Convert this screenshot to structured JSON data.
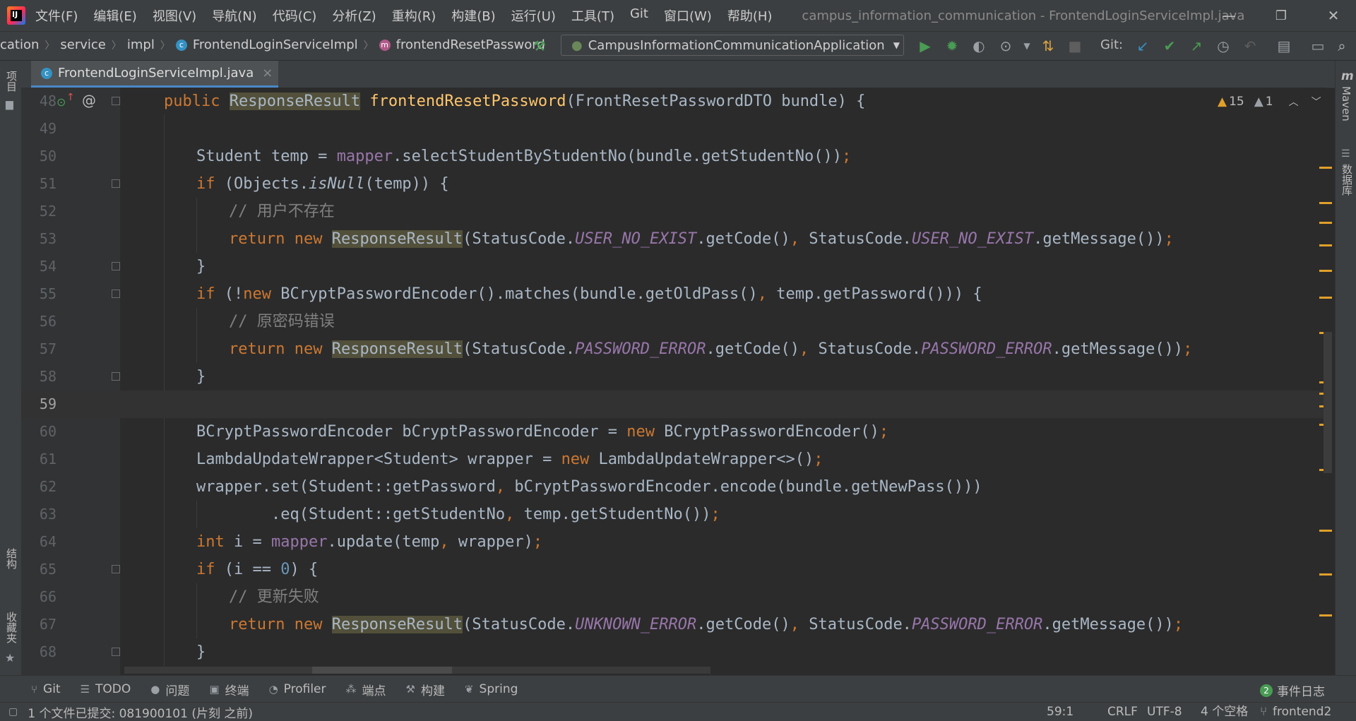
{
  "menu": {
    "logo_text": "IJ",
    "items": [
      "文件(F)",
      "编辑(E)",
      "视图(V)",
      "导航(N)",
      "代码(C)",
      "分析(Z)",
      "重构(R)",
      "构建(B)",
      "运行(U)",
      "工具(T)",
      "Git",
      "窗口(W)",
      "帮助(H)"
    ],
    "window_title": "campus_information_communication - FrontendLoginServiceImpl.java"
  },
  "window_controls": {
    "minimize": "—",
    "restore": "❐",
    "close": "✕"
  },
  "breadcrumb": [
    "cation",
    "service",
    "impl",
    "FrontendLoginServiceImpl",
    "frontendResetPassword"
  ],
  "run_config": "CampusInformationCommunicationApplication",
  "git_label": "Git:",
  "tab": {
    "label": "FrontendLoginServiceImpl.java",
    "close": "×"
  },
  "left_strip": {
    "project": "项目",
    "structure": "结构",
    "favorites": "收藏夹"
  },
  "right_strip": {
    "maven_icon": "m",
    "maven": "Maven",
    "database": "数据库"
  },
  "inspections": {
    "warnings": "15",
    "weak_warnings": "1"
  },
  "code": {
    "lines": [
      {
        "n": "48",
        "segments": [
          [
            "kw",
            "public "
          ],
          [
            "hl",
            "ResponseResult"
          ],
          [
            "",
            " "
          ],
          [
            "fn",
            "frontendResetPassword"
          ],
          [
            "",
            "(FrontResetPasswordDTO bundle) {"
          ]
        ],
        "indent": 0
      },
      {
        "n": "49",
        "segments": [],
        "indent": 0
      },
      {
        "n": "50",
        "segments": [
          [
            "",
            "Student temp = "
          ],
          [
            "fld",
            "mapper"
          ],
          [
            "",
            ".selectStudentByStudentNo(bundle.getStudentNo())"
          ],
          [
            "kw",
            ";"
          ]
        ],
        "indent": 1
      },
      {
        "n": "51",
        "segments": [
          [
            "kw",
            "if "
          ],
          [
            "",
            "(Objects."
          ],
          [
            "ital",
            "isNull"
          ],
          [
            "",
            "(temp)) {"
          ]
        ],
        "indent": 1
      },
      {
        "n": "52",
        "segments": [
          [
            "cm",
            "// 用户不存在"
          ]
        ],
        "indent": 2
      },
      {
        "n": "53",
        "segments": [
          [
            "kw",
            "return new "
          ],
          [
            "hl",
            "ResponseResult"
          ],
          [
            "",
            "(StatusCode."
          ],
          [
            "sfld",
            "USER_NO_EXIST"
          ],
          [
            "",
            ".getCode()"
          ],
          [
            "kw",
            ", "
          ],
          [
            "",
            "StatusCode."
          ],
          [
            "sfld",
            "USER_NO_EXIST"
          ],
          [
            "",
            ".getMessage())"
          ],
          [
            "kw",
            ";"
          ]
        ],
        "indent": 2
      },
      {
        "n": "54",
        "segments": [
          [
            "",
            "}"
          ]
        ],
        "indent": 1
      },
      {
        "n": "55",
        "segments": [
          [
            "kw",
            "if "
          ],
          [
            "",
            "(!"
          ],
          [
            "kw",
            "new "
          ],
          [
            "",
            "BCryptPasswordEncoder().matches(bundle.getOldPass()"
          ],
          [
            "kw",
            ", "
          ],
          [
            "",
            "temp.getPassword())) {"
          ]
        ],
        "indent": 1
      },
      {
        "n": "56",
        "segments": [
          [
            "cm",
            "// 原密码错误"
          ]
        ],
        "indent": 2
      },
      {
        "n": "57",
        "segments": [
          [
            "kw",
            "return new "
          ],
          [
            "hl",
            "ResponseResult"
          ],
          [
            "",
            "(StatusCode."
          ],
          [
            "sfld",
            "PASSWORD_ERROR"
          ],
          [
            "",
            ".getCode()"
          ],
          [
            "kw",
            ", "
          ],
          [
            "",
            "StatusCode."
          ],
          [
            "sfld",
            "PASSWORD_ERROR"
          ],
          [
            "",
            ".getMessage())"
          ],
          [
            "kw",
            ";"
          ]
        ],
        "indent": 2
      },
      {
        "n": "58",
        "segments": [
          [
            "",
            "}"
          ]
        ],
        "indent": 1
      },
      {
        "n": "59",
        "segments": [],
        "indent": 0,
        "caret": true
      },
      {
        "n": "60",
        "segments": [
          [
            "",
            "BCryptPasswordEncoder bCryptPasswordEncoder = "
          ],
          [
            "kw",
            "new "
          ],
          [
            "",
            "BCryptPasswordEncoder()"
          ],
          [
            "kw",
            ";"
          ]
        ],
        "indent": 1
      },
      {
        "n": "61",
        "segments": [
          [
            "",
            "LambdaUpdateWrapper<Student> wrapper = "
          ],
          [
            "kw",
            "new "
          ],
          [
            "",
            "LambdaUpdateWrapper<>()"
          ],
          [
            "kw",
            ";"
          ]
        ],
        "indent": 1
      },
      {
        "n": "62",
        "segments": [
          [
            "",
            "wrapper.set(Student::getPassword"
          ],
          [
            "kw",
            ", "
          ],
          [
            "",
            "bCryptPasswordEncoder.encode(bundle.getNewPass()))"
          ]
        ],
        "indent": 1
      },
      {
        "n": "63",
        "segments": [
          [
            "",
            "        .eq(Student::getStudentNo"
          ],
          [
            "kw",
            ", "
          ],
          [
            "",
            "temp.getStudentNo())"
          ],
          [
            "kw",
            ";"
          ]
        ],
        "indent": 1
      },
      {
        "n": "64",
        "segments": [
          [
            "kw",
            "int "
          ],
          [
            "",
            "i = "
          ],
          [
            "fld",
            "mapper"
          ],
          [
            "",
            ".update(temp"
          ],
          [
            "kw",
            ", "
          ],
          [
            "",
            "wrapper)"
          ],
          [
            "kw",
            ";"
          ]
        ],
        "indent": 1
      },
      {
        "n": "65",
        "segments": [
          [
            "kw",
            "if "
          ],
          [
            "",
            "(i == "
          ],
          [
            "num",
            "0"
          ],
          [
            "",
            ") {"
          ]
        ],
        "indent": 1
      },
      {
        "n": "66",
        "segments": [
          [
            "cm",
            "// 更新失败"
          ]
        ],
        "indent": 2
      },
      {
        "n": "67",
        "segments": [
          [
            "kw",
            "return new "
          ],
          [
            "hl",
            "ResponseResult"
          ],
          [
            "",
            "(StatusCode."
          ],
          [
            "sfld",
            "UNKNOWN_ERROR"
          ],
          [
            "",
            ".getCode()"
          ],
          [
            "kw",
            ", "
          ],
          [
            "",
            "StatusCode."
          ],
          [
            "sfld",
            "PASSWORD_ERROR"
          ],
          [
            "",
            ".getMessage())"
          ],
          [
            "kw",
            ";"
          ]
        ],
        "indent": 2
      },
      {
        "n": "68",
        "segments": [
          [
            "",
            "}"
          ]
        ],
        "indent": 1
      }
    ]
  },
  "bottom_tools": [
    "Git",
    "TODO",
    "问题",
    "终端",
    "Profiler",
    "端点",
    "构建",
    "Spring"
  ],
  "event_log": {
    "count": "2",
    "label": "事件日志"
  },
  "status": {
    "message": "1 个文件已提交: 081900101 (片刻 之前)",
    "position": "59:1",
    "line_sep": "CRLF",
    "encoding": "UTF-8",
    "indent": "4 个空格",
    "branch": "frontend2"
  },
  "colors": {
    "keyword": "#cc7832",
    "method": "#ffc66d",
    "field": "#9876aa",
    "comment": "#808080",
    "number": "#6897bb",
    "text": "#a9b7c6",
    "background": "#2b2b2b"
  }
}
